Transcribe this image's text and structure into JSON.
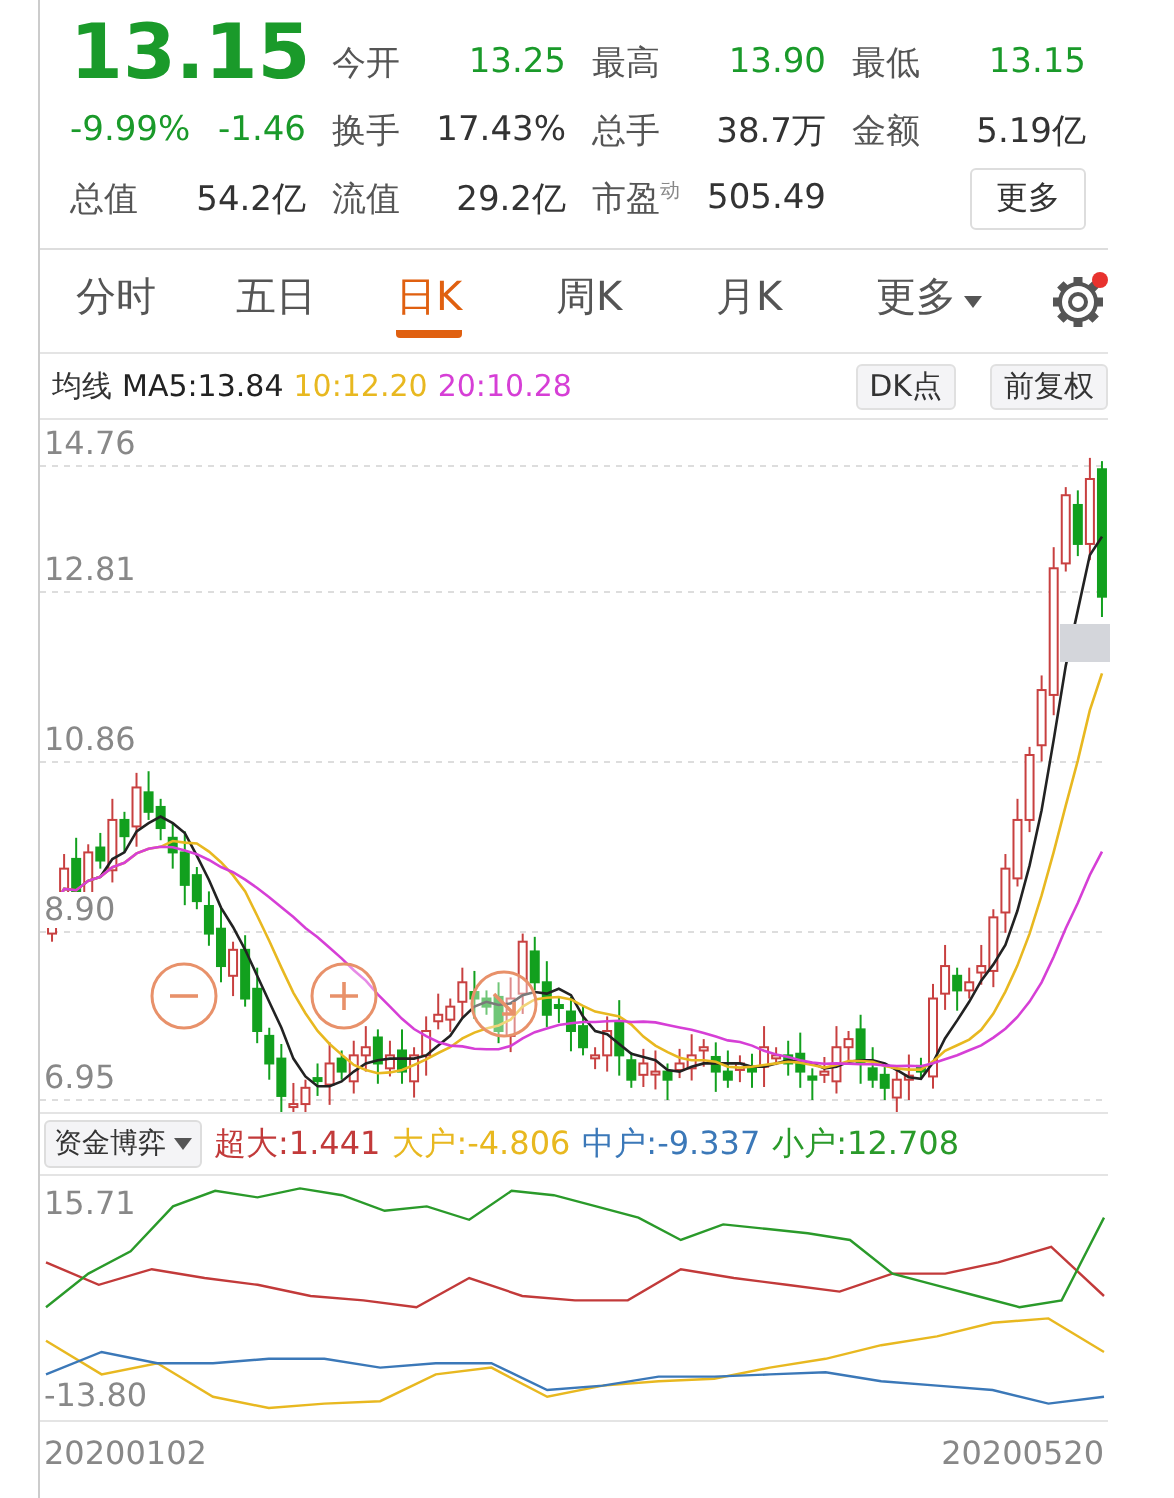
{
  "quote": {
    "price": "13.15",
    "change_pct": "-9.99%",
    "change": "-1.46",
    "color": "#1a9a2a",
    "stats": [
      {
        "label": "今开",
        "value": "13.25",
        "color": "#1a9a2a"
      },
      {
        "label": "最高",
        "value": "13.90",
        "color": "#1a9a2a"
      },
      {
        "label": "最低",
        "value": "13.15",
        "color": "#1a9a2a"
      },
      {
        "label": "换手",
        "value": "17.43%",
        "color": "#333333"
      },
      {
        "label": "总手",
        "value": "38.7万",
        "color": "#333333"
      },
      {
        "label": "金额",
        "value": "5.19亿",
        "color": "#333333"
      },
      {
        "label": "总值",
        "value": "54.2亿",
        "color": "#333333"
      },
      {
        "label": "流值",
        "value": "29.2亿",
        "color": "#333333"
      },
      {
        "label": "市盈$^{动}$",
        "value": "505.49",
        "color": "#333333"
      }
    ],
    "more_button": "更多"
  },
  "tabs": [
    {
      "label": "分时",
      "selected": false
    },
    {
      "label": "五日",
      "selected": false
    },
    {
      "label": "日K",
      "selected": true
    },
    {
      "label": "周K",
      "selected": false
    },
    {
      "label": "月K",
      "selected": false
    },
    {
      "label": "更多",
      "selected": false,
      "kind": "menu"
    }
  ],
  "settings": {
    "badge": true
  },
  "ma_legend": {
    "label": "均线",
    "items": [
      {
        "text": "MA5:13.84",
        "color": "#222222"
      },
      {
        "text": "10:12.20",
        "color": "#e8b820"
      },
      {
        "text": "20:10.28",
        "color": "#d63fd6"
      }
    ]
  },
  "chart_buttons": [
    "DK点",
    "前复权"
  ],
  "price_axis": [
    "14.76",
    "12.81",
    "10.86",
    "8.90",
    "6.95"
  ],
  "indicator": {
    "dropdown": "资金博弈",
    "values": [
      {
        "text": "超大:1.441",
        "color": "#c23a3a"
      },
      {
        "text": "大户:-4.806",
        "color": "#e8b820"
      },
      {
        "text": "中户:-9.337",
        "color": "#3b78b8"
      },
      {
        "text": "小户:12.708",
        "color": "#2a9a2a"
      }
    ],
    "axis": [
      "15.71",
      "-13.80"
    ]
  },
  "dates": [
    "20200102",
    "20200520"
  ]
}
